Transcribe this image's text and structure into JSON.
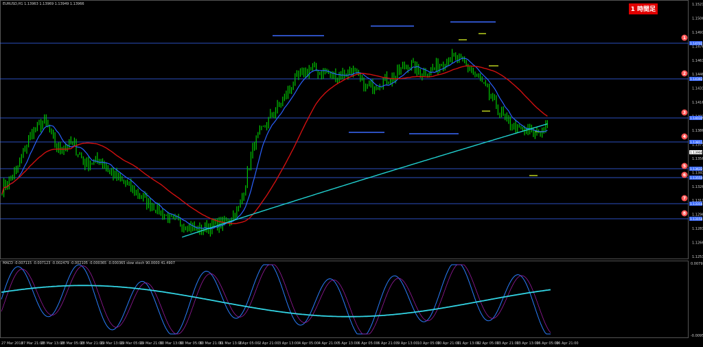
{
  "main_header": "EURUSD,H1  1.13963 1.13969 1.13949 1.13966",
  "sub_header": "MACD -0.007115 -0.007123 -0.002479 -0.002105 -0.000365 -0.000365  slow stoch 90.0000 41.4907",
  "badge": "1 時間足",
  "colors": {
    "background": "#000000",
    "candles": "#00c800",
    "ma_fast": "#2a62ff",
    "ma_mid": "#d21010",
    "ma_slow": "#21d0d0",
    "levels": "#3c6bff",
    "green_marks": "#c8e020",
    "circle_fill": "#ff5252"
  },
  "price_axis": {
    "labels": [
      "1.15210",
      "1.15060",
      "1.14910",
      "1.14760",
      "1.14610",
      "1.14460",
      "1.14310",
      "1.14160",
      "1.14010",
      "1.13860",
      "1.13710",
      "1.13560",
      "1.13410",
      "1.13260",
      "1.13110",
      "1.12960",
      "1.12810",
      "1.12660",
      "1.12510"
    ],
    "current": "1.13966",
    "level_tags": [
      "1.14702",
      "1.14392",
      "1.14030",
      "1.13811",
      "1.13632",
      "1.13550",
      "1.13314",
      "1.13154"
    ]
  },
  "level_marks": [
    "1",
    "2",
    "3",
    "4",
    "5",
    "6",
    "7",
    "8"
  ],
  "osc_axis": {
    "top": "0.007923",
    "bottom": "-0.009573"
  },
  "time_axis": [
    "27 Mar 2018",
    "27 Mar 21:00",
    "28 Mar 13:00",
    "28 Mar 05:00",
    "28 Mar 21:00",
    "29 Mar 13:00",
    "29 Mar 05:00",
    "29 Mar 21:00",
    "30 Mar 13:00",
    "30 Mar 05:00",
    "30 Mar 21:00",
    "31 Mar 13:00",
    "2 Apr 05:00",
    "2 Apr 21:00",
    "3 Apr 13:00",
    "4 Apr 05:00",
    "4 Apr 21:00",
    "5 Apr 13:00",
    "6 Apr 05:00",
    "6 Apr 21:00",
    "9 Apr 13:00",
    "10 Apr 05:00",
    "10 Apr 21:00",
    "11 Apr 13:00",
    "12 Apr 05:00",
    "13 Apr 21:00",
    "13 Apr 13:00",
    "16 Apr 05:00",
    "16 Apr 21:00"
  ],
  "chart_data": {
    "type": "line",
    "symbol": "EURUSD,H1",
    "price_range": [
      1.1251,
      1.1521
    ],
    "closes_key": [
      1.1325,
      1.1342,
      1.138,
      1.1395,
      1.1365,
      1.1372,
      1.135,
      1.1355,
      1.1338,
      1.1328,
      1.1315,
      1.1305,
      1.1292,
      1.1288,
      1.1282,
      1.1285,
      1.129,
      1.1305,
      1.137,
      1.1395,
      1.1415,
      1.1438,
      1.145,
      1.1445,
      1.1442,
      1.1448,
      1.143,
      1.1435,
      1.144,
      1.1455,
      1.1445,
      1.145,
      1.1462,
      1.1455,
      1.144,
      1.1418,
      1.1395,
      1.1385,
      1.1382,
      1.1388
    ],
    "resistance_levels": [
      1.14702,
      1.14392,
      1.1403,
      1.13811,
      1.13632,
      1.1355,
      1.13314,
      1.13154
    ],
    "ma_slow_range": [
      1.1205,
      1.1392
    ],
    "ylabel": "",
    "xlabel": ""
  }
}
